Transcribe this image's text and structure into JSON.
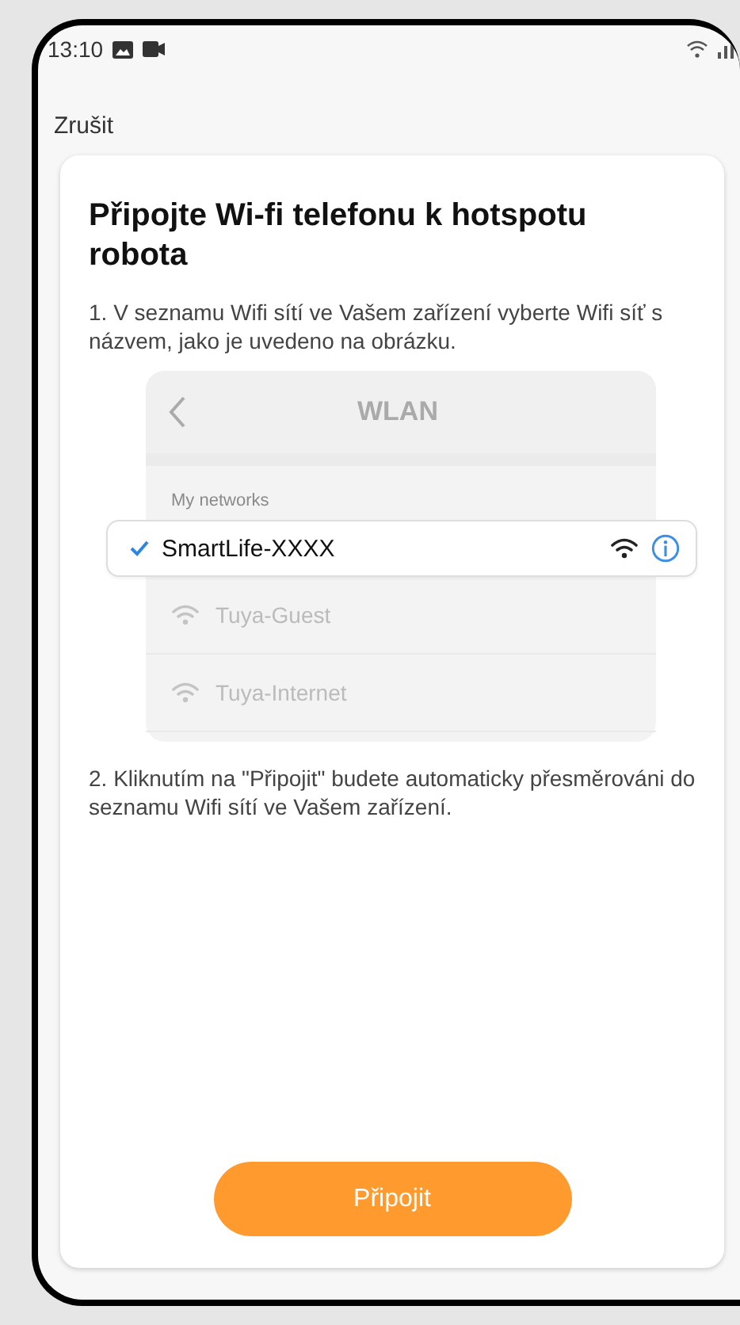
{
  "status_bar": {
    "time": "13:10"
  },
  "header": {
    "cancel": "Zrušit"
  },
  "card": {
    "title": "Připojte Wi-fi telefonu k hotspotu robota",
    "step_1": "1. V seznamu Wifi sítí ve Vašem zařízení vyberte Wifi síť s názvem, jako je uvedeno na obrázku.",
    "illustration": {
      "title": "WLAN",
      "section": "My networks",
      "networks": [
        {
          "name": "SmartLife-XXXX",
          "selected": true
        },
        {
          "name": "Tuya-Guest",
          "selected": false
        },
        {
          "name": "Tuya-Internet",
          "selected": false
        }
      ]
    },
    "step_2": "2. Kliknutím na \"Připojit\" budete automaticky přesměrováni do seznamu Wifi sítí ve Vašem zařízení.",
    "button": "Připojit"
  }
}
